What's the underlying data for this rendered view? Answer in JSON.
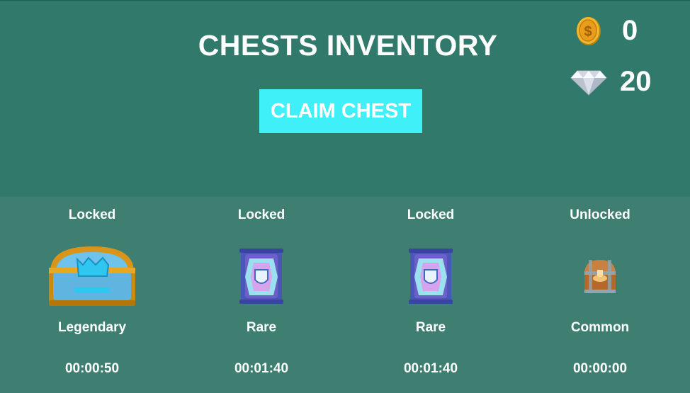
{
  "header": {
    "title": "CHESTS INVENTORY",
    "claim_button_label": "CLAIM CHEST"
  },
  "currency": {
    "coins": {
      "icon": "coin-icon",
      "value": "0"
    },
    "gems": {
      "icon": "diamond-icon",
      "value": "20"
    }
  },
  "chests": [
    {
      "status": "Locked",
      "rarity": "Legendary",
      "timer": "00:00:50",
      "icon": "legendary-chest-icon"
    },
    {
      "status": "Locked",
      "rarity": "Rare",
      "timer": "00:01:40",
      "icon": "rare-chest-icon"
    },
    {
      "status": "Locked",
      "rarity": "Rare",
      "timer": "00:01:40",
      "icon": "rare-chest-icon"
    },
    {
      "status": "Unlocked",
      "rarity": "Common",
      "timer": "00:00:00",
      "icon": "common-chest-icon"
    }
  ],
  "colors": {
    "top_panel": "#317a6b",
    "bottom_panel": "#3f7f72",
    "claim_button": "#3ff0f8",
    "text": "#ffffff"
  }
}
